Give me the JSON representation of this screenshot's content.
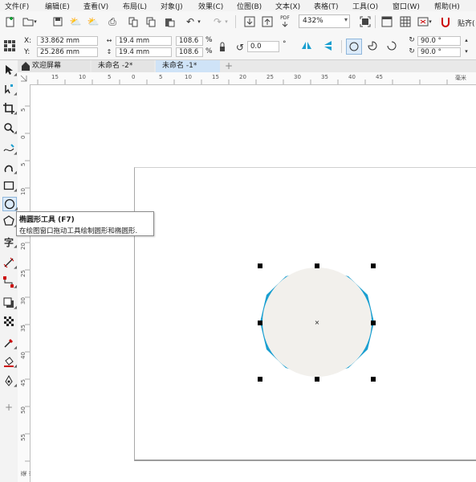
{
  "menu": [
    {
      "label": "文件(F)"
    },
    {
      "label": "编辑(E)"
    },
    {
      "label": "查看(V)"
    },
    {
      "label": "布局(L)"
    },
    {
      "label": "对象(J)"
    },
    {
      "label": "效果(C)"
    },
    {
      "label": "位图(B)"
    },
    {
      "label": "文本(X)"
    },
    {
      "label": "表格(T)"
    },
    {
      "label": "工具(O)"
    },
    {
      "label": "窗口(W)"
    },
    {
      "label": "帮助(H)"
    }
  ],
  "toolbar": {
    "zoom": "432%",
    "paste_label": "贴齐(",
    "pdf_label": "PDF"
  },
  "properties": {
    "x_label": "X:",
    "y_label": "Y:",
    "x_value": "33.862 mm",
    "y_value": "25.286 mm",
    "width_value": "19.4 mm",
    "height_value": "19.4 mm",
    "scale_x": "108.6",
    "scale_y": "108.6",
    "percent": "%",
    "rotation": "0.0",
    "degree_symbol": "°",
    "start_angle": "90.0 °",
    "end_angle": "90.0 °"
  },
  "tabs": [
    {
      "label": "欢迎屏幕"
    },
    {
      "label": "未命名 -2*"
    },
    {
      "label": "未命名 -1*"
    }
  ],
  "add_tab_label": "+",
  "ruler": {
    "h_ticks": [
      "15",
      "10",
      "5",
      "0",
      "5",
      "10",
      "15",
      "20",
      "25",
      "30",
      "35",
      "40",
      "45"
    ],
    "v_ticks": [
      "5",
      "0",
      "5",
      "10",
      "15",
      "20",
      "25",
      "30",
      "35",
      "40",
      "45",
      "50",
      "55"
    ],
    "h_unit": "毫米",
    "v_unit": "毫米"
  },
  "tooltip": {
    "title": "椭圆形工具 (F7)",
    "description": "在绘图窗口拖动工具绘制圆形和椭圆形."
  },
  "shape": {
    "fill": "#f2f0ec",
    "stroke": "#1a9fd0",
    "center_marker": "×"
  },
  "colors": {
    "accent": "#1a9fd0",
    "tab_active": "#cfe3f7"
  }
}
